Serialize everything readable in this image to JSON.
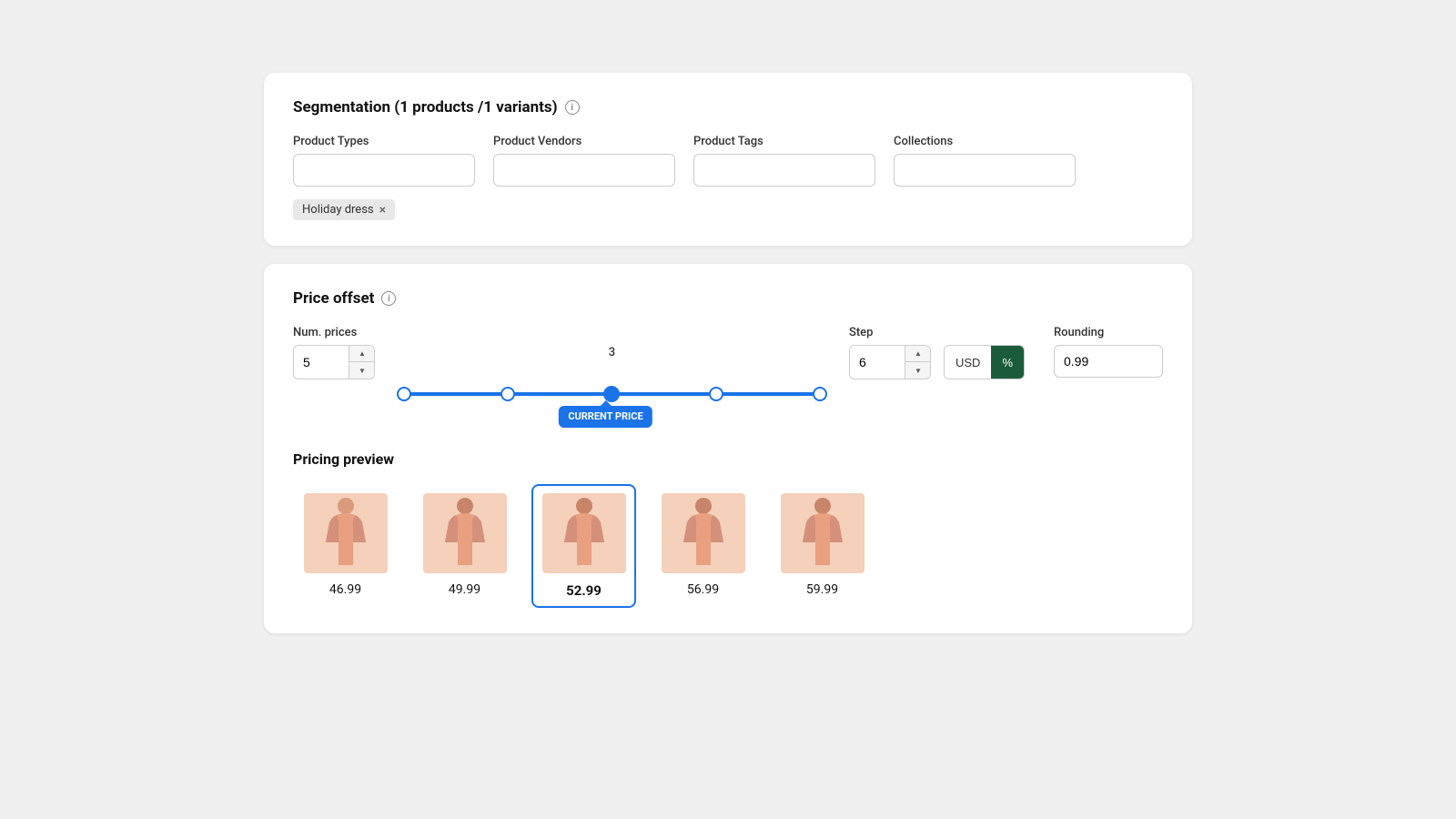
{
  "segmentation": {
    "title": "Segmentation (1 products /1 variants)",
    "info_icon": "i",
    "fields": [
      {
        "label": "Product Types",
        "value": "",
        "placeholder": ""
      },
      {
        "label": "Product Vendors",
        "value": "",
        "placeholder": ""
      },
      {
        "label": "Product Tags",
        "value": "",
        "placeholder": ""
      },
      {
        "label": "Collections",
        "value": "",
        "placeholder": ""
      }
    ],
    "tags": [
      {
        "label": "Holiday dress",
        "removable": true
      }
    ]
  },
  "price_offset": {
    "title": "Price offset",
    "num_prices": {
      "label": "Num. prices",
      "value": "5"
    },
    "slider": {
      "active_position_label": "3",
      "current_price_tooltip": "CURRENT PRICE",
      "dots": [
        0,
        25,
        50,
        75,
        100
      ],
      "active_index": 2
    },
    "step": {
      "label": "Step",
      "value": "6"
    },
    "currency_toggle": {
      "options": [
        "USD",
        "%"
      ],
      "active": "%"
    },
    "rounding": {
      "label": "Rounding",
      "value": "0.99"
    }
  },
  "pricing_preview": {
    "title": "Pricing preview",
    "products": [
      {
        "price": "46.99",
        "selected": false
      },
      {
        "price": "49.99",
        "selected": false
      },
      {
        "price": "52.99",
        "selected": true
      },
      {
        "price": "56.99",
        "selected": false
      },
      {
        "price": "59.99",
        "selected": false
      }
    ]
  }
}
